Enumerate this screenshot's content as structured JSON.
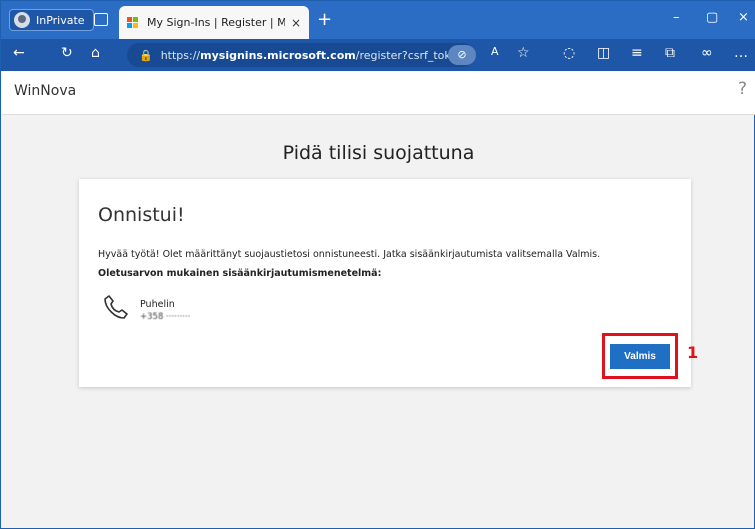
{
  "browser": {
    "profile_label": "InPrivate",
    "tab_title": "My Sign-Ins | Register | Microsoft",
    "tab_close": "×",
    "new_tab": "+",
    "url_prefix": "https://",
    "url_host": "mysignins.microsoft.com",
    "url_path": "/register?csrf_token...",
    "window_min": "–",
    "window_max": "▢",
    "window_close": "×"
  },
  "page": {
    "brand": "WinNova",
    "help": "?",
    "heading": "Pidä tilisi suojattuna"
  },
  "card": {
    "title": "Onnistui!",
    "message": "Hyvää työtä! Olet määrittänyt suojaustietosi onnistuneesti. Jatka sisäänkirjautumista valitsemalla Valmis.",
    "default_label": "Oletusarvon mukainen sisäänkirjautumismenetelmä:",
    "method_name": "Puhelin",
    "method_number": "+358 ·········",
    "done_button": "Valmis"
  },
  "annotation": {
    "step_number": "1",
    "color": "#e0101c"
  },
  "colors": {
    "titlebar": "#2b6cc4",
    "toolbar": "#1e56a8",
    "button": "#1f6fc4"
  }
}
